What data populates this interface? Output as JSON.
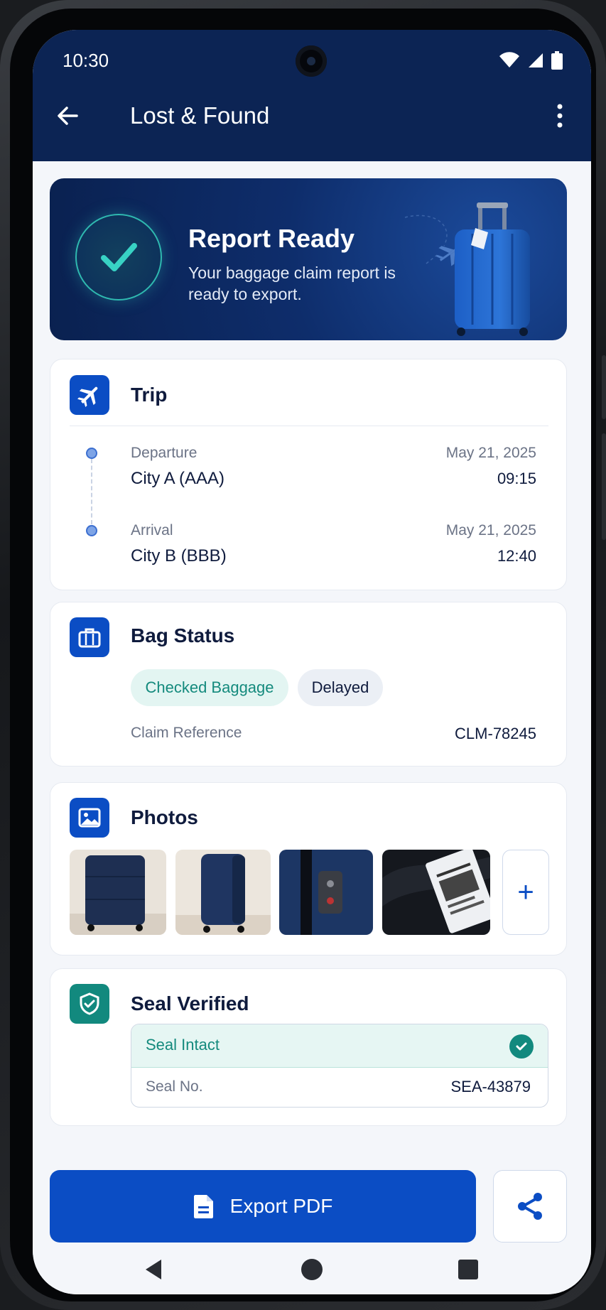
{
  "status_bar": {
    "time": "10:30"
  },
  "app_bar": {
    "title": "Lost & Found"
  },
  "banner": {
    "title": "Report Ready",
    "subtitle": "Your baggage claim report is ready to export."
  },
  "trip": {
    "title": "Trip",
    "departure": {
      "label": "Departure",
      "place": "City A (AAA)",
      "date": "May 21, 2025",
      "time": "09:15"
    },
    "arrival": {
      "label": "Arrival",
      "place": "City B (BBB)",
      "date": "May 21, 2025",
      "time": "12:40"
    }
  },
  "bag_status": {
    "title": "Bag Status",
    "chips": [
      "Checked Baggage",
      "Delayed"
    ],
    "claim_label": "Claim Reference",
    "claim_value": "CLM-78245"
  },
  "photos": {
    "title": "Photos",
    "add_label": "+"
  },
  "seal": {
    "title": "Seal Verified",
    "status": "Seal Intact",
    "number_label": "Seal No.",
    "number": "SEA-43879"
  },
  "actions": {
    "export_label": "Export PDF"
  },
  "colors": {
    "primary": "#0b4dc4",
    "header": "#0c2454",
    "teal": "#12897e"
  }
}
